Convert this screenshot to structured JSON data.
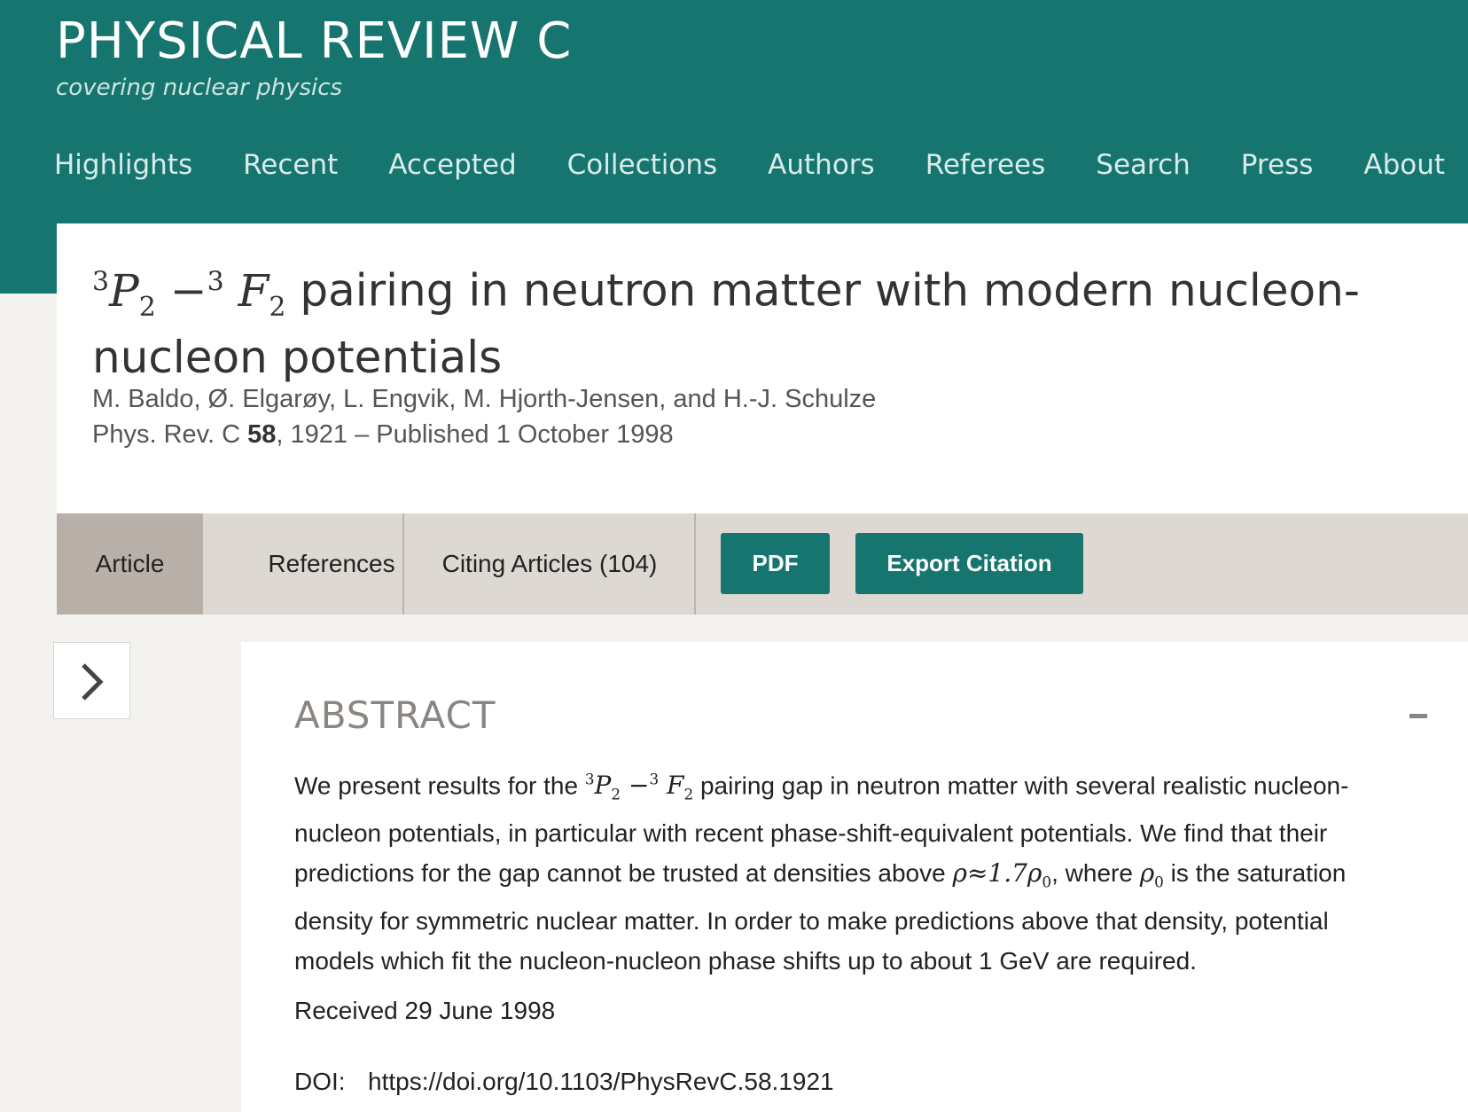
{
  "header": {
    "journal_title": "PHYSICAL REVIEW C",
    "subtitle": "covering nuclear physics",
    "nav": [
      "Highlights",
      "Recent",
      "Accepted",
      "Collections",
      "Authors",
      "Referees",
      "Search",
      "Press",
      "About"
    ]
  },
  "article": {
    "title_math": {
      "sup1": "3",
      "v1": "P",
      "sub1": "2",
      "op": " −",
      "sup2": "3",
      "v2": "F",
      "sub2": "2"
    },
    "title_text": " pairing in neutron matter with modern nucleon-nucleon potentials",
    "authors": "M. Baldo, Ø. Elgarøy, L. Engvik, M. Hjorth-Jensen, and H.-J. Schulze",
    "citation": {
      "journal": "Phys. Rev. C",
      "volume": "58",
      "rest": ", 1921 – Published 1 October 1998"
    }
  },
  "tabs": {
    "article": "Article",
    "references": "References",
    "citing": "Citing Articles (104)",
    "pdf": "PDF",
    "export": "Export Citation"
  },
  "abstract": {
    "heading": "ABSTRACT",
    "p1": "We present results for the ",
    "p2": " pairing gap in neutron matter with several realistic nucleon-nucleon potentials, in particular with recent phase-shift-equivalent potentials. We find that their predictions for the gap cannot be trusted at densities above ",
    "rho_expr": "ρ≈1.7ρ",
    "rho_sub": "0",
    "p3": ", where ",
    "rho0": "ρ",
    "rho0_sub": "0",
    "p4": " is the saturation density for symmetric nuclear matter. In order to make predictions above that density, potential models which fit the nucleon-nucleon phase shifts up to about 1 GeV are required.",
    "received": "Received 29 June 1998",
    "doi_label": "DOI:",
    "doi": "https://doi.org/10.1103/PhysRevC.58.1921"
  }
}
